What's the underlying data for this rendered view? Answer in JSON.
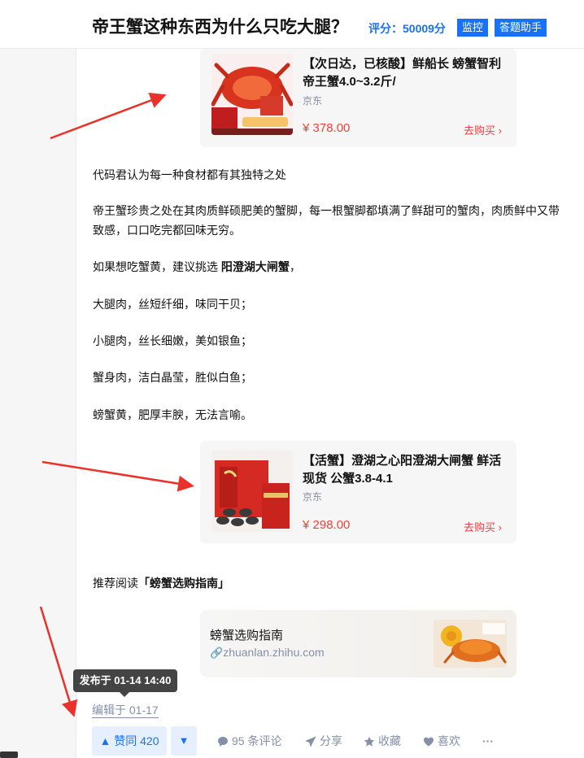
{
  "header": {
    "question_title": "帝王蟹这种东西为什么只吃大腿？",
    "score_label": "评分：50009分",
    "monitor_button": "监控",
    "helper_button": "答题助手"
  },
  "product_cards": [
    {
      "title": "【次日达，已核酸】鲜船长 螃蟹智利帝王蟹4.0~3.2斤/",
      "source": "京东",
      "price": "¥ 378.00",
      "buy_label": "去购买 ›"
    },
    {
      "title": "【活蟹】澄湖之心阳澄湖大闸蟹 鲜活现货 公蟹3.8-4.1",
      "source": "京东",
      "price": "¥ 298.00",
      "buy_label": "去购买 ›"
    }
  ],
  "article": {
    "p1": "代码君认为每一种食材都有其独特之处",
    "p2_line1": "帝王蟹珍贵之处在其肉质鲜硕肥美的蟹脚，每一根蟹脚都填满了鲜甜可的蟹肉，肉质鲜中又带",
    "p2_line2": "致感，口口吃完都回味无穷。",
    "p3_prefix": "如果想吃蟹黄，建议挑选 ",
    "p3_bold": "阳澄湖大闸蟹",
    "p3_suffix": "，",
    "p4": "大腿肉，丝短纤细，味同干贝；",
    "p5": "小腿肉，丝长细嫩，美如银鱼；",
    "p6": "蟹身肉，洁白晶莹，胜似白鱼；",
    "p7": "螃蟹黄，肥厚丰腴，无法言喻。",
    "recommend_prefix": "推荐阅读",
    "recommend_bold": "「螃蟹选购指南」"
  },
  "link_card": {
    "title": "螃蟹选购指南",
    "url": "zhuanlan.zhihu.com"
  },
  "meta": {
    "tooltip": "发布于 01-14 14:40",
    "edited": "编辑于 01-17"
  },
  "actions": {
    "upvote": "▲ 赞同 420",
    "downvote": "▼",
    "comments": "95 条评论",
    "share": "分享",
    "favorite": "收藏",
    "like": "喜欢",
    "more": "···"
  },
  "colors": {
    "brand_blue": "#1772f6",
    "price_red": "#f1403c",
    "arrow_red": "#e8322b"
  }
}
